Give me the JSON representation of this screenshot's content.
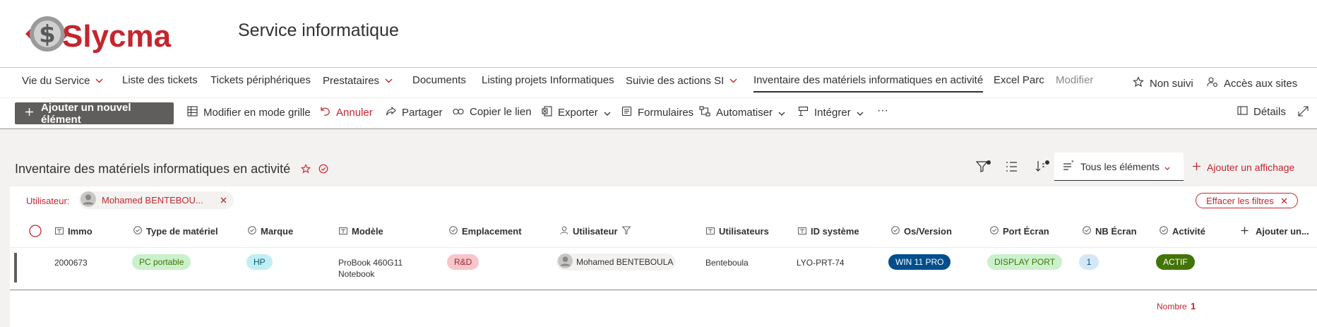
{
  "header": {
    "logo_text": "Slycma",
    "site_title": "Service informatique"
  },
  "nav": {
    "items": [
      {
        "label": "Vie du Service"
      },
      {
        "label": "Liste des tickets"
      },
      {
        "label": "Tickets périphériques"
      },
      {
        "label": "Prestataires"
      },
      {
        "label": "Documents"
      },
      {
        "label": "Listing projets Informatiques"
      },
      {
        "label": "Suivie des actions SI"
      },
      {
        "label": "Inventaire des matériels informatiques en activité"
      },
      {
        "label": "Excel Parc"
      },
      {
        "label": "Modifier"
      }
    ],
    "follow_label": "Non suivi",
    "sites_label": "Accès aux sites"
  },
  "commands": {
    "new_item": "Ajouter un nouvel élément",
    "grid_edit": "Modifier en mode grille",
    "cancel": "Annuler",
    "share": "Partager",
    "copy_link": "Copier le lien",
    "export": "Exporter",
    "forms": "Formulaires",
    "automate": "Automatiser",
    "integrate": "Intégrer",
    "more": "···",
    "details": "Détails"
  },
  "list": {
    "title": "Inventaire des matériels informatiques en activité",
    "view_name": "Tous les éléments",
    "add_view": "Ajouter un affichage",
    "filter_label": "Utilisateur:",
    "filter_value": "Mohamed BENTEBOU...",
    "clear_filters": "Effacer les filtres",
    "columns": [
      "Immo",
      "Type de matériel",
      "Marque",
      "Modèle",
      "Emplacement",
      "Utilisateur",
      "Utilisateurs",
      "ID système",
      "Os/Version",
      "Port Écran",
      "NB Écran",
      "Activité",
      "Ajouter un..."
    ],
    "rows": [
      {
        "immo": "2000673",
        "type": "PC portable",
        "marque": "HP",
        "modele_line1": "ProBook 460G11",
        "modele_line2": "Notebook",
        "emplacement": "R&D",
        "utilisateur": "Mohamed BENTEBOULA",
        "utilisateurs": "Benteboula",
        "id_systeme": "LYO-PRT-74",
        "os": "WIN 11 PRO",
        "port": "DISPLAY PORT",
        "nb_ecran": "1",
        "activite": "ACTIF"
      }
    ],
    "count_label": "Nombre",
    "count_value": "1"
  },
  "colors": {
    "accent": "#c4262e",
    "pill_green_bg": "#caf0cc",
    "pill_cyan_bg": "#c0eef4",
    "pill_red_bg": "#f7c5ca",
    "pill_blue_bg": "#004e8c",
    "pill_darkgreen_bg": "#437406",
    "pill_lightblue_bg": "#d4e7f6"
  }
}
